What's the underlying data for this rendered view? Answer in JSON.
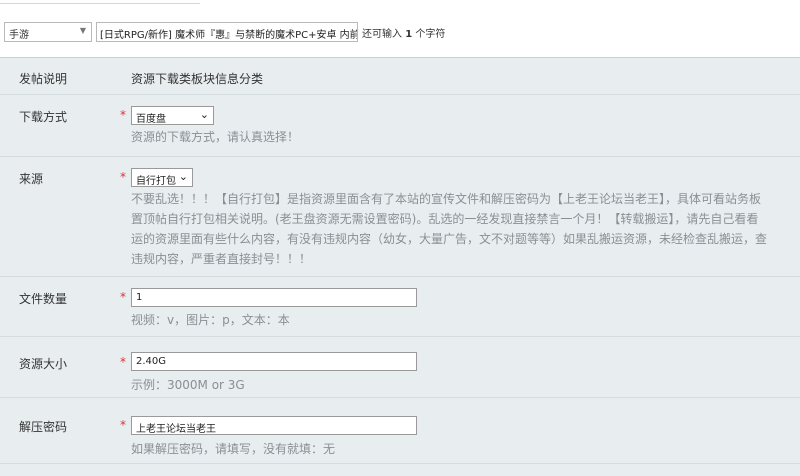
{
  "title_row": {
    "category_value": "手游",
    "title_value": "[日式RPG/新作] 魔术师『惠』与禁断的魔术PC+安卓 内前",
    "hint_prefix": "还可输入",
    "hint_count": "1",
    "hint_suffix": "个字符"
  },
  "form": {
    "description": {
      "label": "发帖说明",
      "value": "资源下载类板块信息分类"
    },
    "download_method": {
      "label": "下载方式",
      "required": "*",
      "selected": "百度盘",
      "help": "资源的下载方式，请认真选择！"
    },
    "source": {
      "label": "来源",
      "required": "*",
      "selected": "自行打包",
      "help_lines": [
        "不要乱选！！！【自行打包】是指资源里面含有了本站的宣传文件和解压密码为【上老王论坛当老王】，具体可看站务板",
        "置顶帖自行打包相关说明。(老王盘资源无需设置密码)。乱选的一经发现直接禁言一个月！【转载搬运】，请先自己看看",
        "运的资源里面有些什么内容，有没有违规内容（幼女，大量广告，文不对题等等）如果乱搬运资源，未经检查乱搬运，查",
        "违规内容，严重者直接封号！！！"
      ]
    },
    "file_count": {
      "label": "文件数量",
      "required": "*",
      "value": "1",
      "help": "视频：v，图片：p，文本：本"
    },
    "resource_size": {
      "label": "资源大小",
      "required": "*",
      "value": "2.40G",
      "help": "示例：3000M or 3G"
    },
    "password": {
      "label": "解压密码",
      "required": "*",
      "value": "上老王论坛当老王",
      "help": "如果解压密码，请填写，没有就填：无"
    }
  },
  "colors": {
    "panel_bg": "#e8eef0",
    "required": "#e03030",
    "help_text": "#8a8f93"
  }
}
